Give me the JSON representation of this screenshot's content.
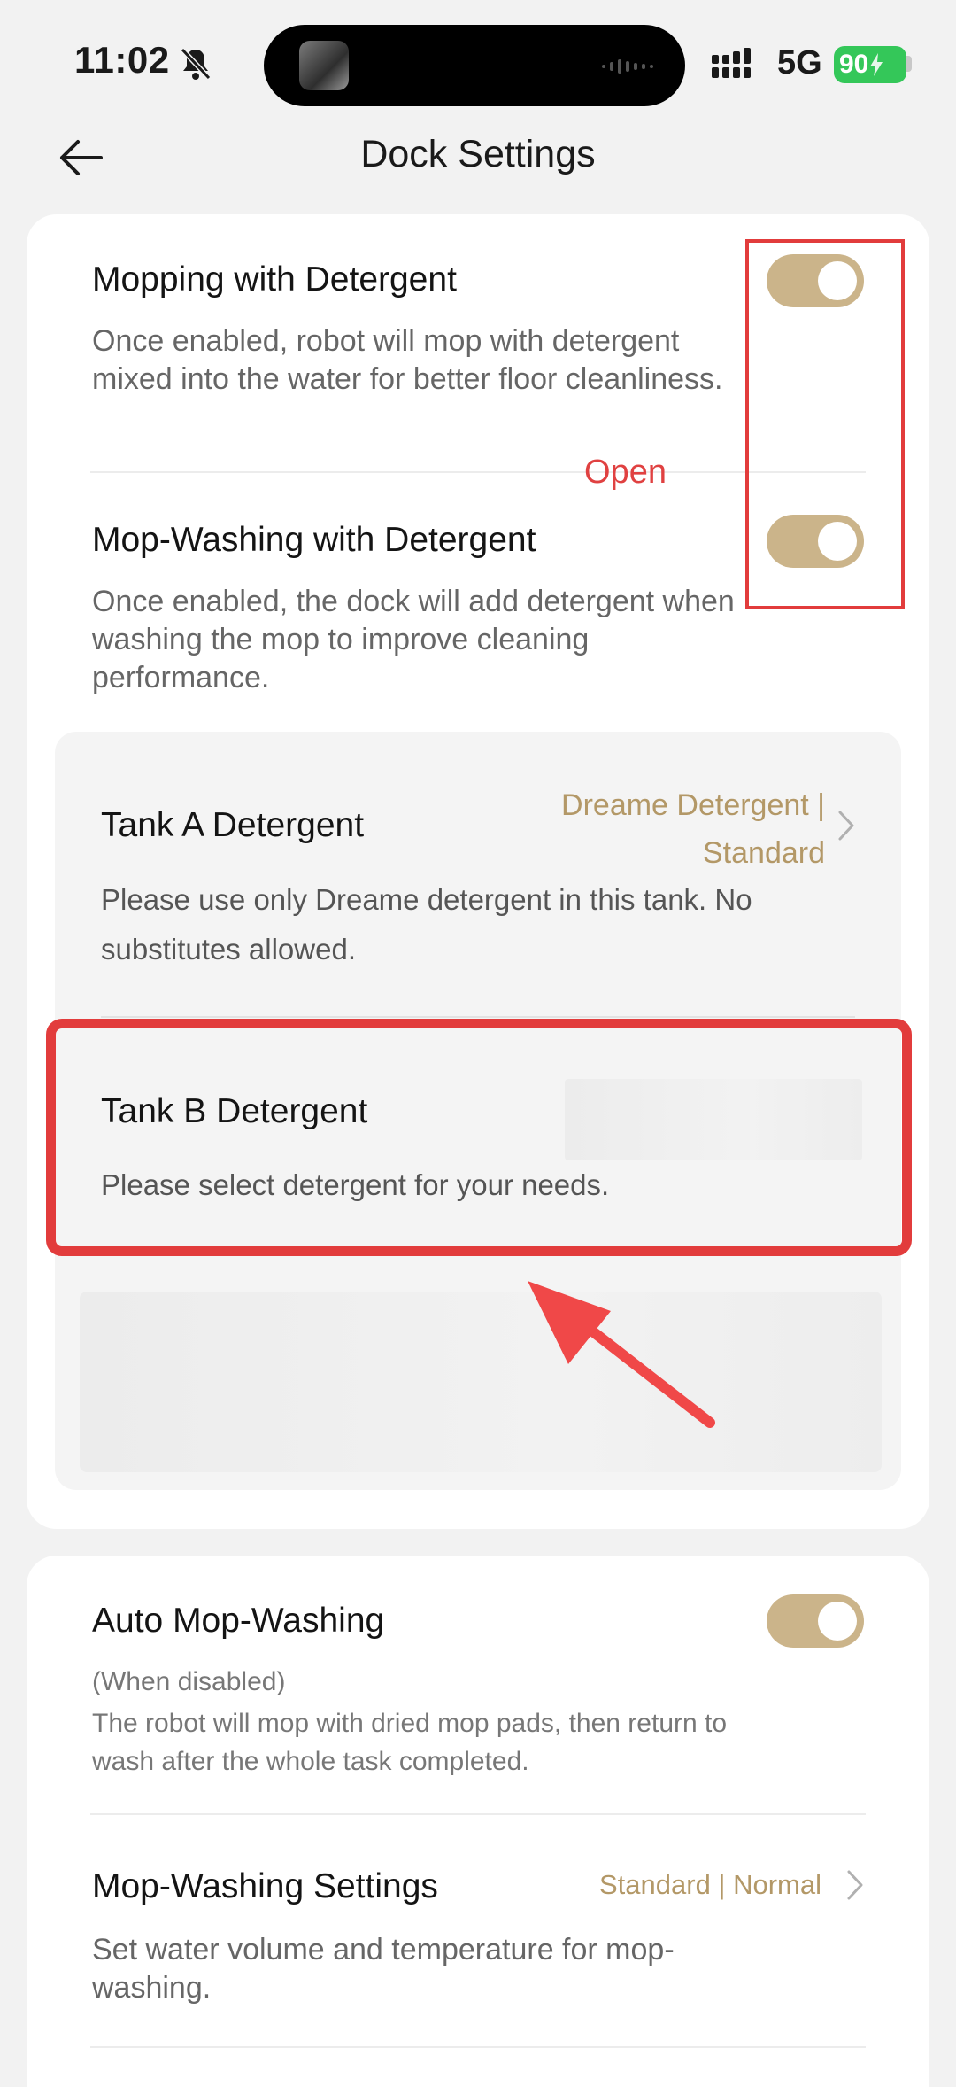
{
  "status_bar": {
    "time": "11:02",
    "network": "5G",
    "battery": "90",
    "icons": [
      "bell-muted-icon",
      "signal-icon",
      "battery-charging-icon"
    ]
  },
  "header": {
    "title": "Dock Settings",
    "back_icon": "arrow-left-icon"
  },
  "section1": {
    "mopping_detergent": {
      "title": "Mopping with Detergent",
      "desc": "Once enabled, robot will mop with detergent mixed into the water for better floor cleanliness.",
      "enabled": true
    },
    "mop_washing_detergent": {
      "title": "Mop-Washing with Detergent",
      "desc": "Once enabled, the dock will add detergent when washing the mop to improve cleaning performance.",
      "enabled": true
    },
    "tank_a": {
      "title": "Tank A Detergent",
      "value": "Dreame Detergent | Standard",
      "desc": "Please use only Dreame detergent in this tank. No substitutes allowed."
    },
    "tank_b": {
      "title": "Tank B Detergent",
      "desc": "Please select detergent for your needs."
    }
  },
  "annotation": {
    "open_label": "Open",
    "highlight_color": "#e23c3c"
  },
  "section2": {
    "auto_mop_washing": {
      "title": "Auto Mop-Washing",
      "note": "(When disabled)",
      "desc": "The robot will mop with dried mop pads, then return to wash after the whole task completed.",
      "enabled": true
    },
    "mop_washing_settings": {
      "title": "Mop-Washing Settings",
      "value": "Standard | Normal",
      "desc": "Set water volume and temperature for mop-washing."
    }
  },
  "colors": {
    "toggle_on": "#cbb48a",
    "accent_text": "#b39867",
    "annotation_red": "#e23c3c"
  }
}
